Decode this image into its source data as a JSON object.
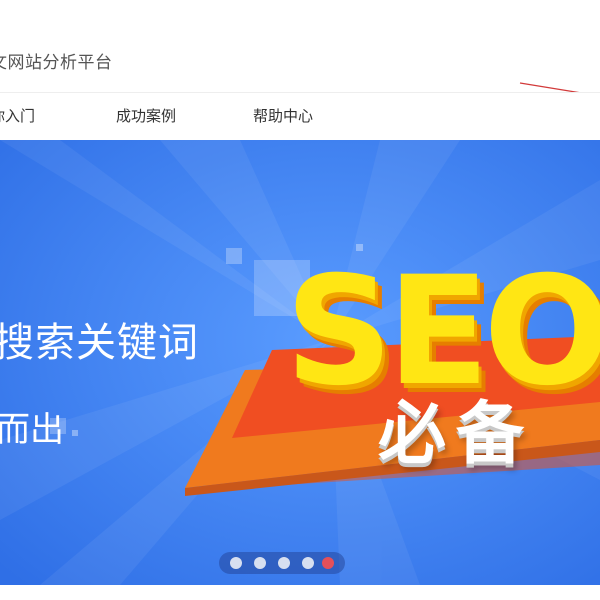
{
  "header": {
    "site_title": "文网站分析平台"
  },
  "nav": {
    "items": [
      {
        "label": "你入门"
      },
      {
        "label": "成功案例"
      },
      {
        "label": "帮助中心"
      }
    ]
  },
  "banner": {
    "headline": "搜索关键词",
    "subline": "而出",
    "big_text": "SEO",
    "badge_text": "必备",
    "colors": {
      "background": "#3c82f4",
      "seo_yellow": "#ffe614",
      "stage_orange": "#f07a1e",
      "stage_red": "#f04e22"
    }
  },
  "carousel": {
    "slide_count": 5,
    "active_index": 4,
    "active_color": "#e4505a"
  }
}
